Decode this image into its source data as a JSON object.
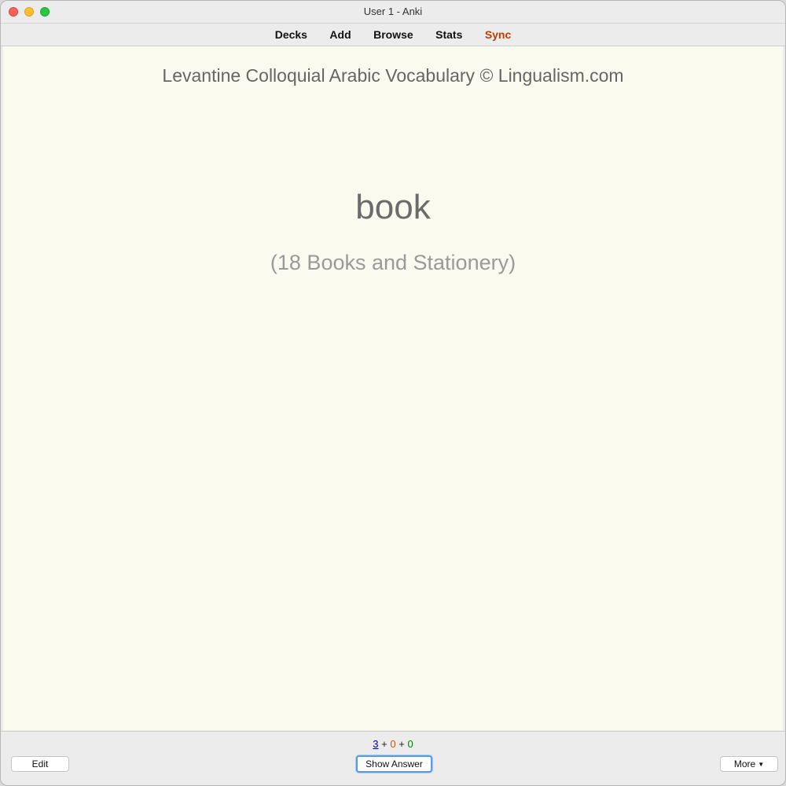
{
  "window": {
    "title": "User 1 - Anki"
  },
  "toolbar": {
    "items": [
      {
        "label": "Decks"
      },
      {
        "label": "Add"
      },
      {
        "label": "Browse"
      },
      {
        "label": "Stats"
      },
      {
        "label": "Sync"
      }
    ],
    "sync_color": "#c23b00"
  },
  "card": {
    "deck_header": "Levantine Colloquial Arabic Vocabulary © Lingualism.com",
    "word": "book",
    "category": "(18 Books and Stationery)",
    "background": "#fafaee"
  },
  "bottom": {
    "counts": {
      "new": "3",
      "plus1": "+",
      "learning": "0",
      "plus2": "+",
      "review": "0"
    },
    "edit_label": "Edit",
    "show_answer_label": "Show Answer",
    "more_label": "More",
    "more_icon": "caret-down-icon"
  }
}
